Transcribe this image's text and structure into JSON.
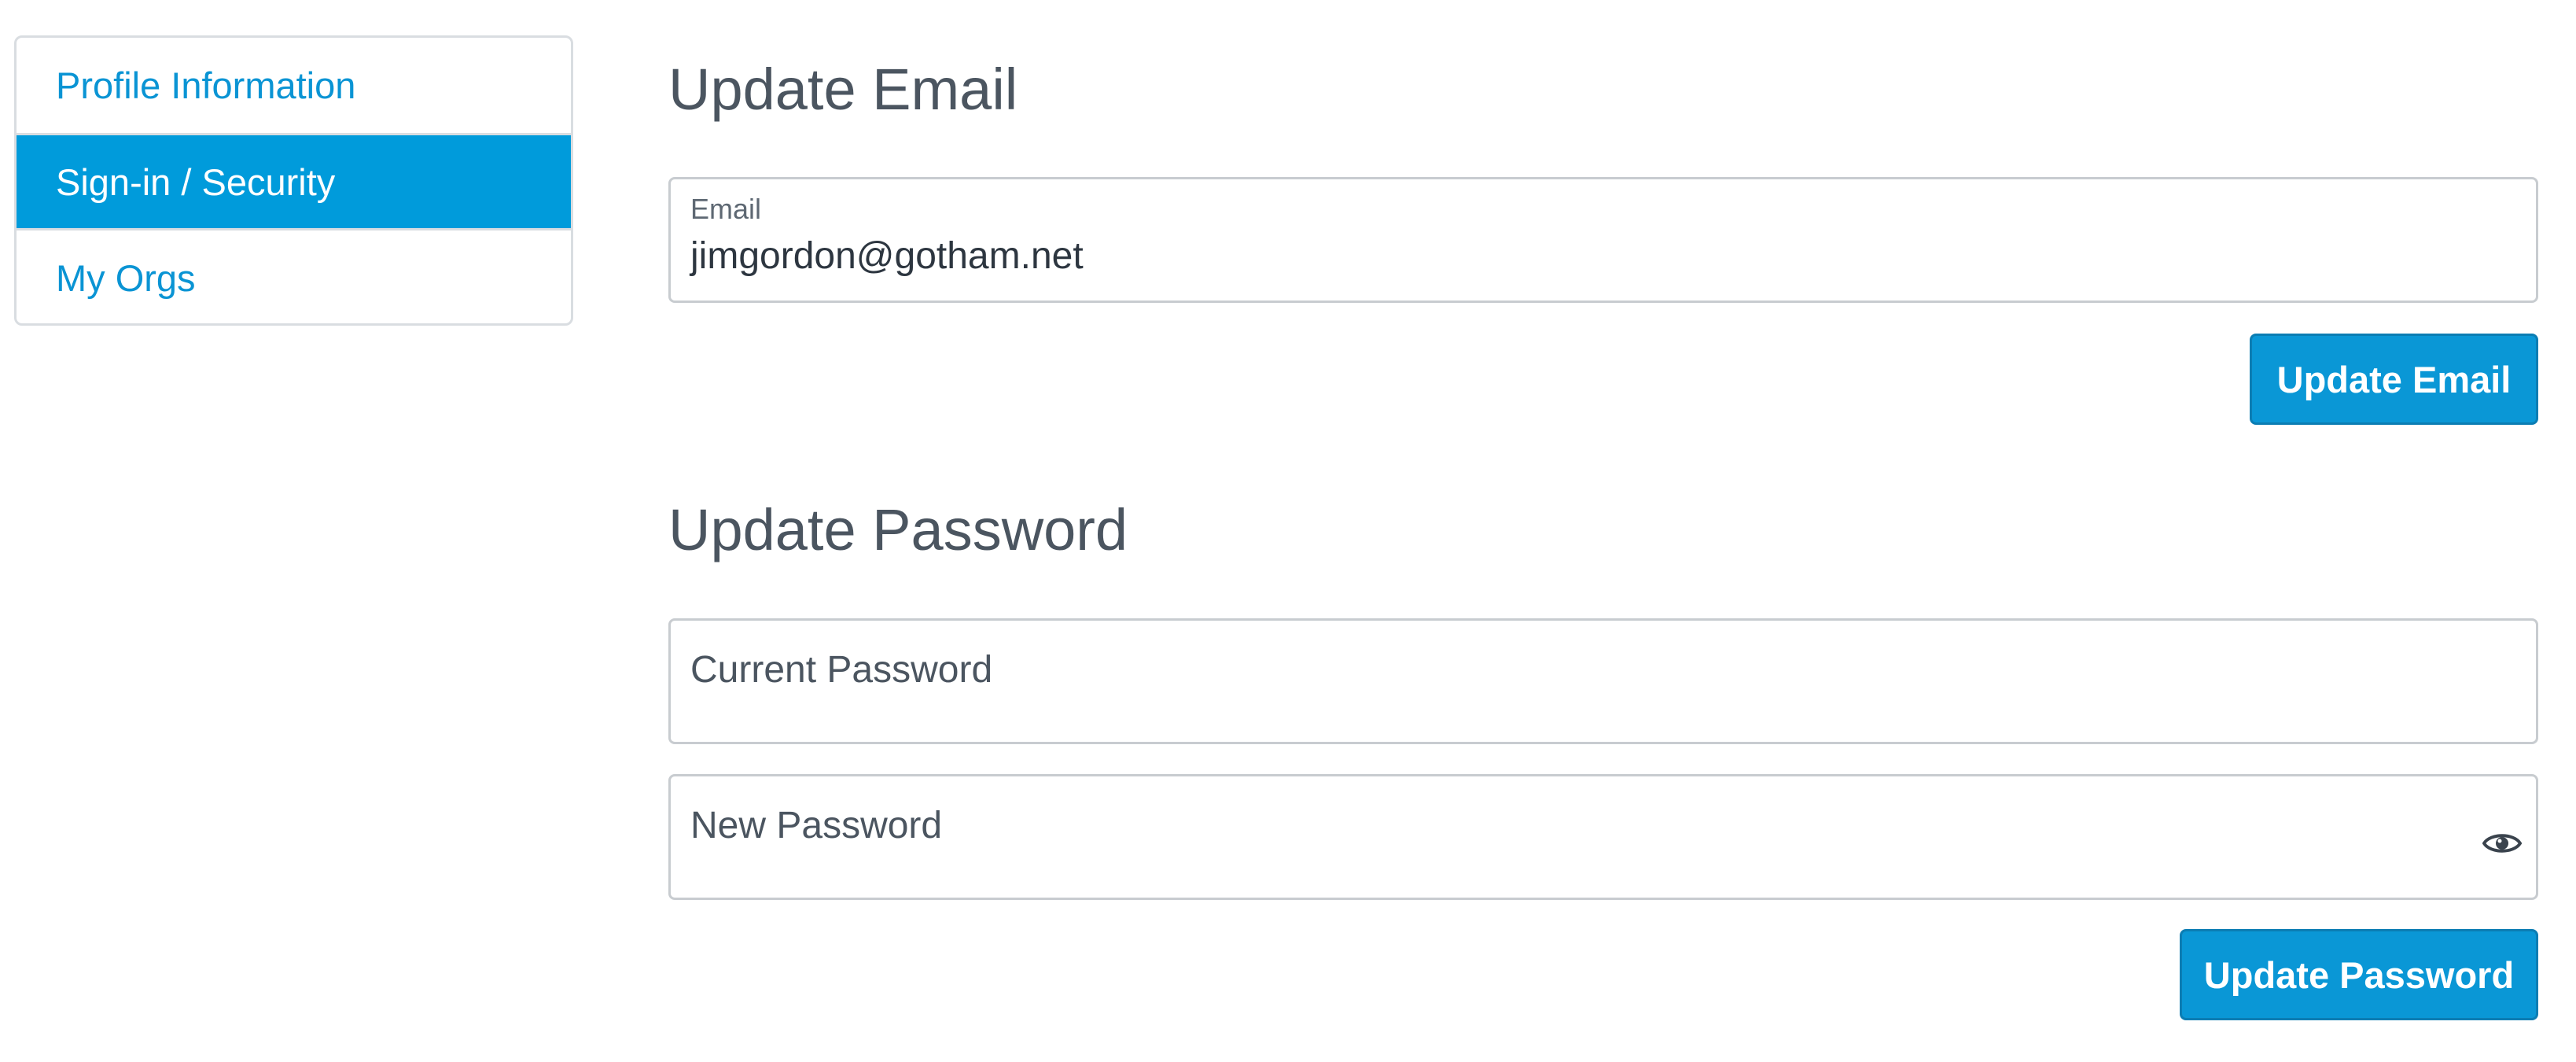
{
  "sidebar": {
    "items": [
      {
        "label": "Profile Information",
        "active": false
      },
      {
        "label": "Sign-in / Security",
        "active": true
      },
      {
        "label": "My Orgs",
        "active": false
      }
    ]
  },
  "email_section": {
    "title": "Update Email",
    "email_label": "Email",
    "email_value": "jimgordon@gotham.net",
    "button_label": "Update Email"
  },
  "password_section": {
    "title": "Update Password",
    "current_password_placeholder": "Current Password",
    "new_password_placeholder": "New Password",
    "show_password_icon": "eye-icon",
    "button_label": "Update Password"
  },
  "colors": {
    "accent": "#009bdb",
    "link": "#0a94d4",
    "heading": "#4b5560",
    "border": "#c8ccd0"
  }
}
